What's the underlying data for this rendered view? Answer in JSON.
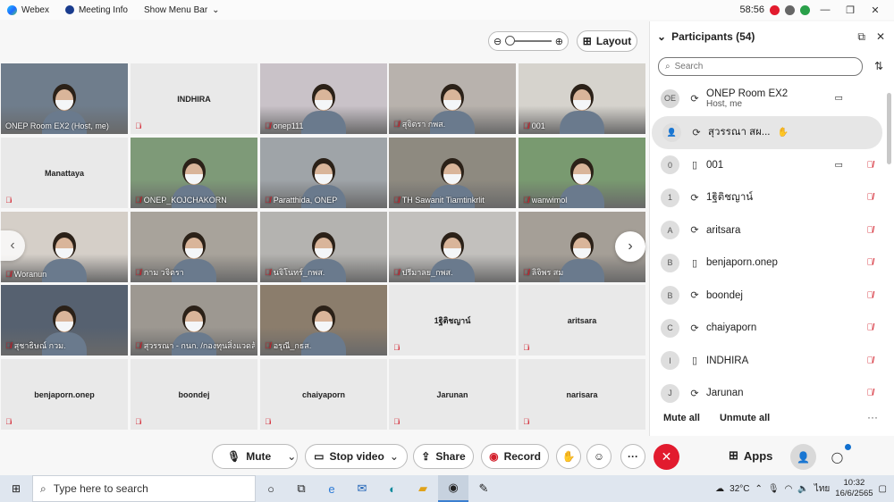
{
  "titlebar": {
    "app_name": "Webex",
    "meeting_info": "Meeting Info",
    "show_menu_bar": "Show Menu Bar",
    "timer": "58:56",
    "minimize": "—",
    "restore": "❐",
    "close": "✕"
  },
  "layout_button": "Layout",
  "tiles": [
    {
      "name": "ONEP Room EX2 (Host, me)",
      "video": true,
      "bg": "#6f7d8c",
      "mic": false
    },
    {
      "name": "INDHIRA",
      "video": false,
      "mic": true
    },
    {
      "name": "onep111",
      "video": true,
      "bg": "#c9c2c8",
      "mic": true
    },
    {
      "name": "สุจิตรา กพส.",
      "video": true,
      "bg": "#b8b2ad",
      "mic": true
    },
    {
      "name": "001",
      "video": true,
      "bg": "#d6d3cd",
      "mic": true
    },
    {
      "name": "Manattaya",
      "video": false,
      "mic": true,
      "center": true
    },
    {
      "name": "ONEP_KOJCHAKORN",
      "video": true,
      "bg": "#7e9a78",
      "mic": true
    },
    {
      "name": "Paratthida, ONEP",
      "video": true,
      "bg": "#9fa4a8",
      "mic": true
    },
    {
      "name": "TH Sawanit Tiamtinkrlit",
      "video": true,
      "bg": "#8e8a80",
      "mic": true
    },
    {
      "name": "wanwimol",
      "video": true,
      "bg": "#799a70",
      "mic": true
    },
    {
      "name": "Woranun",
      "video": true,
      "bg": "#d5cfc8",
      "mic": true
    },
    {
      "name": "กาม วจิตรา",
      "video": true,
      "bg": "#a8a39b",
      "mic": true
    },
    {
      "name": "นจิโนทร์_กพส.",
      "video": true,
      "bg": "#b4b3b0",
      "mic": true
    },
    {
      "name": "ปรีมาลย_กพส.",
      "video": true,
      "bg": "#c2c0bd",
      "mic": true
    },
    {
      "name": "ลิจิพร สม",
      "video": true,
      "bg": "#a59f97",
      "mic": true
    },
    {
      "name": "สุชาธิษณ์ กวม.",
      "video": true,
      "bg": "#566170",
      "mic": true
    },
    {
      "name": "สุวรรณา - กนก. /กองทุนสิ่งแวดล้อ",
      "video": true,
      "bg": "#9d9891",
      "mic": true
    },
    {
      "name": "อรุณี_กธส.",
      "video": true,
      "bg": "#8b7d6c",
      "mic": true
    },
    {
      "name": "1ฐิติชญาน์",
      "video": false,
      "mic": true
    },
    {
      "name": "aritsara",
      "video": false,
      "mic": true
    },
    {
      "name": "benjaporn.onep",
      "video": false,
      "mic": true
    },
    {
      "name": "boondej",
      "video": false,
      "mic": true
    },
    {
      "name": "chaiyaporn",
      "video": false,
      "mic": true
    },
    {
      "name": "Jarunan",
      "video": false,
      "mic": true
    },
    {
      "name": "narisara",
      "video": false,
      "mic": true
    }
  ],
  "participants": {
    "title": "Participants (54)",
    "search_placeholder": "Search",
    "list": [
      {
        "initials": "OE",
        "name": "ONEP Room EX2",
        "sub": "Host, me",
        "device": "⟳",
        "cam": true,
        "muted": false
      },
      {
        "initials": "",
        "name": "สุวรรณา สผ...",
        "sub": "",
        "device": "⟳",
        "cam": false,
        "muted": false,
        "highlight": true,
        "hand": true
      },
      {
        "initials": "0",
        "name": "001",
        "sub": "",
        "device": "▯",
        "cam": true,
        "muted": true
      },
      {
        "initials": "1",
        "name": "1ฐิติชญาน์",
        "sub": "",
        "device": "⟳",
        "cam": false,
        "muted": true
      },
      {
        "initials": "A",
        "name": "aritsara",
        "sub": "",
        "device": "⟳",
        "cam": false,
        "muted": true
      },
      {
        "initials": "B",
        "name": "benjaporn.onep",
        "sub": "",
        "device": "▯",
        "cam": false,
        "muted": true
      },
      {
        "initials": "B",
        "name": "boondej",
        "sub": "",
        "device": "⟳",
        "cam": false,
        "muted": true
      },
      {
        "initials": "C",
        "name": "chaiyaporn",
        "sub": "",
        "device": "⟳",
        "cam": false,
        "muted": true
      },
      {
        "initials": "I",
        "name": "INDHIRA",
        "sub": "",
        "device": "▯",
        "cam": false,
        "muted": true
      },
      {
        "initials": "J",
        "name": "Jarunan",
        "sub": "",
        "device": "⟳",
        "cam": false,
        "muted": true
      }
    ],
    "mute_all": "Mute all",
    "unmute_all": "Unmute all"
  },
  "controls": {
    "mute": "Mute",
    "stop_video": "Stop video",
    "share": "Share",
    "record": "Record",
    "apps": "Apps"
  },
  "taskbar": {
    "search_placeholder": "Type here to search",
    "temperature": "32°C",
    "language": "ไทย",
    "time": "10:32",
    "date": "16/6/2565"
  },
  "colors": {
    "mute_red": "#d3202c",
    "end_call": "#e21b2e",
    "accent_blue": "#1170cf"
  }
}
